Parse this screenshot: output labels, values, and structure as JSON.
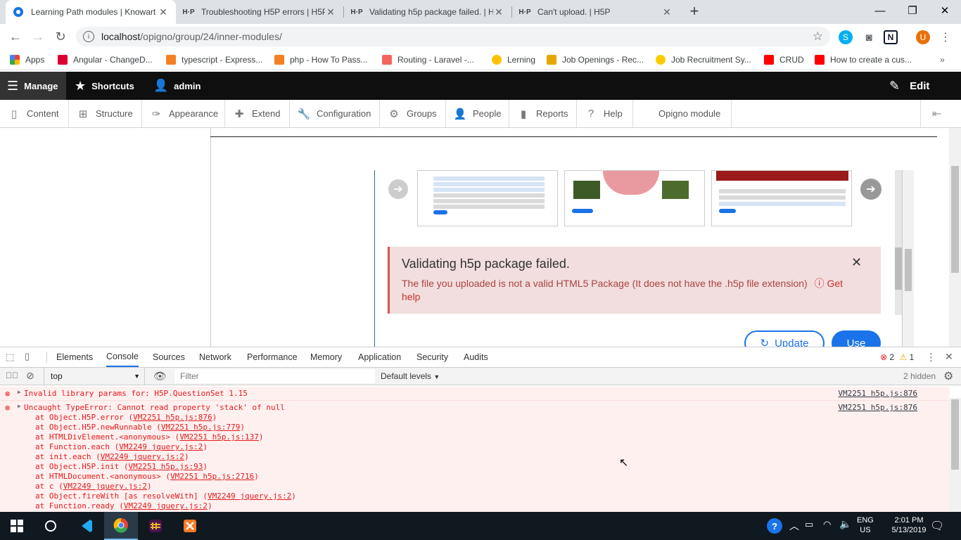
{
  "tabs": [
    {
      "title": "Learning Path modules | Knowart",
      "favicon": "chrome-icon",
      "active": true
    },
    {
      "title": "Troubleshooting H5P errors | H5P",
      "favicon": "h5p-icon"
    },
    {
      "title": "Validating h5p package failed. | H",
      "favicon": "h5p-icon"
    },
    {
      "title": "Can't upload. | H5P",
      "favicon": "h5p-icon"
    }
  ],
  "url": {
    "host": "localhost",
    "path": "/opigno/group/24/inner-modules/"
  },
  "bookmarks": [
    {
      "label": "Apps"
    },
    {
      "label": "Angular - ChangeD...",
      "color": "#dd0031"
    },
    {
      "label": "typescript - Express...",
      "color": "#f48024"
    },
    {
      "label": "php - How To Pass...",
      "color": "#f48024"
    },
    {
      "label": "Routing - Laravel -...",
      "color": "#f4645f"
    },
    {
      "label": "Lerning",
      "color": "#ffc107"
    },
    {
      "label": "Job Openings - Rec...",
      "color": "#e6a700"
    },
    {
      "label": "Job Recruitment Sy...",
      "color": "#ffcc00"
    },
    {
      "label": "CRUD",
      "color": "#ff0000"
    },
    {
      "label": "How to create a cus...",
      "color": "#ff0000"
    }
  ],
  "admin": {
    "manage": "Manage",
    "shortcuts": "Shortcuts",
    "user": "admin",
    "edit": "Edit"
  },
  "tray": [
    "Content",
    "Structure",
    "Appearance",
    "Extend",
    "Configuration",
    "Groups",
    "People",
    "Reports",
    "Help",
    "Opigno module"
  ],
  "alert": {
    "title": "Validating h5p package failed.",
    "message": "The file you uploaded is not a valid HTML5 Package (It does not have the .h5p file extension)",
    "help": "Get help"
  },
  "buttons": {
    "update": "Update",
    "use": "Use"
  },
  "devtools": {
    "tabs": [
      "Elements",
      "Console",
      "Sources",
      "Network",
      "Performance",
      "Memory",
      "Application",
      "Security",
      "Audits"
    ],
    "active_tab": "Console",
    "errors": "2",
    "warnings": "1",
    "context": "top",
    "filter_placeholder": "Filter",
    "levels": "Default levels",
    "hidden": "2 hidden"
  },
  "console": {
    "line1": {
      "text": "Invalid library params for: H5P.QuestionSet 1.15",
      "source": "VM2251 h5p.js:876"
    },
    "line2": {
      "text": "Uncaught TypeError: Cannot read property 'stack' of null",
      "source": "VM2251 h5p.js:876"
    },
    "stack": [
      {
        "pre": "at Object.H5P.error (",
        "link": "VM2251 h5p.js:876",
        "post": ")"
      },
      {
        "pre": "at Object.H5P.newRunnable (",
        "link": "VM2251 h5p.js:779",
        "post": ")"
      },
      {
        "pre": "at HTMLDivElement.<anonymous> (",
        "link": "VM2251 h5p.js:137",
        "post": ")"
      },
      {
        "pre": "at Function.each (",
        "link": "VM2249 jquery.js:2",
        "post": ")"
      },
      {
        "pre": "at init.each (",
        "link": "VM2249 jquery.js:2",
        "post": ")"
      },
      {
        "pre": "at Object.H5P.init (",
        "link": "VM2251 h5p.js:93",
        "post": ")"
      },
      {
        "pre": "at HTMLDocument.<anonymous> (",
        "link": "VM2251 h5p.js:2716",
        "post": ")"
      },
      {
        "pre": "at c (",
        "link": "VM2249 jquery.js:2",
        "post": ")"
      },
      {
        "pre": "at Object.fireWith [as resolveWith] (",
        "link": "VM2249 jquery.js:2",
        "post": ")"
      },
      {
        "pre": "at Function.ready (",
        "link": "VM2249 jquery.js:2",
        "post": ")"
      }
    ]
  },
  "taskbar": {
    "lang": "ENG",
    "region": "US",
    "time": "2:01 PM",
    "date": "5/13/2019"
  }
}
